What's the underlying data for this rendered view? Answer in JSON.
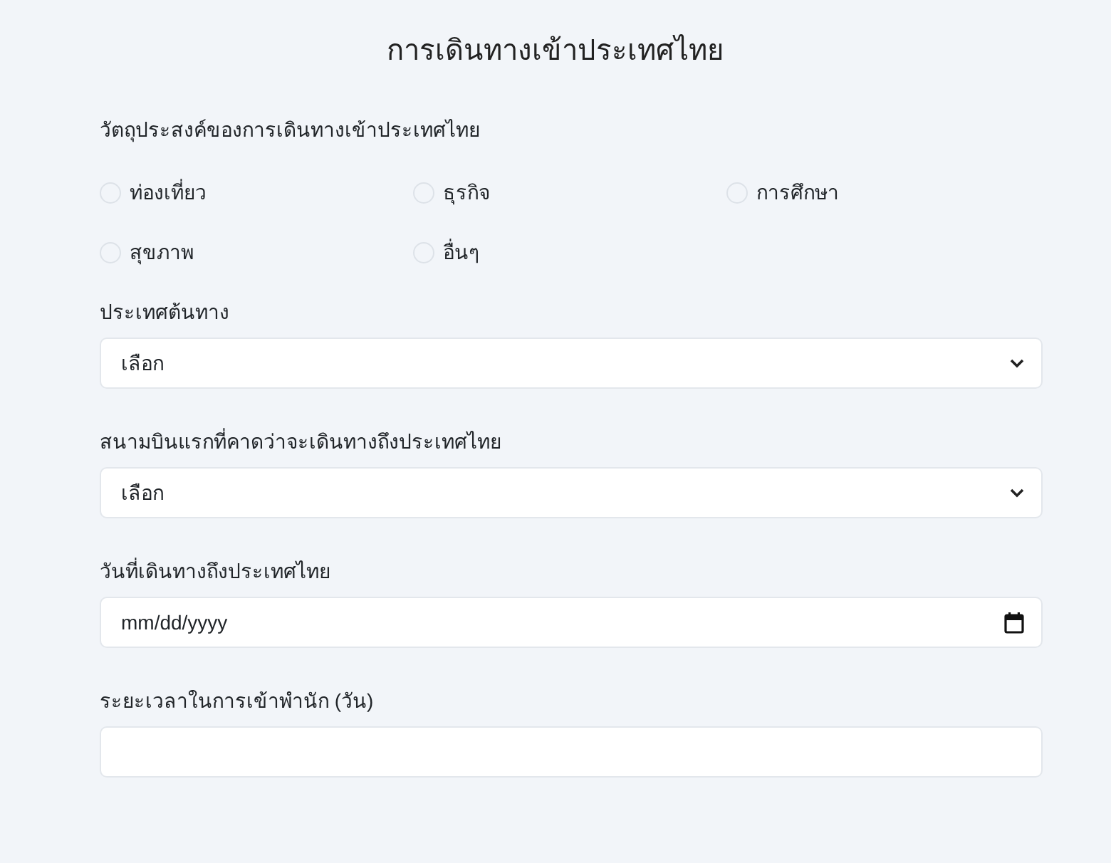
{
  "title": "การเดินทางเข้าประเทศไทย",
  "purpose": {
    "label": "วัตถุประสงค์ของการเดินทางเข้าประเทศไทย",
    "options": [
      {
        "label": "ท่องเที่ยว",
        "selected": false
      },
      {
        "label": "ธุรกิจ",
        "selected": false
      },
      {
        "label": "การศึกษา",
        "selected": false
      },
      {
        "label": "สุขภาพ",
        "selected": false
      },
      {
        "label": "อื่นๆ",
        "selected": false
      }
    ]
  },
  "fields": [
    {
      "kind": "select",
      "label": "ประเทศต้นทาง",
      "value": "เลือก"
    },
    {
      "kind": "select",
      "label": "สนามบินแรกที่คาดว่าจะเดินทางถึงประเทศไทย",
      "value": "เลือก"
    },
    {
      "kind": "date",
      "label": "วันที่เดินทางถึงประเทศไทย",
      "value": "mm/dd/yyyy"
    },
    {
      "kind": "text",
      "label": "ระยะเวลาในการเข้าพำนัก (วัน)"
    }
  ]
}
